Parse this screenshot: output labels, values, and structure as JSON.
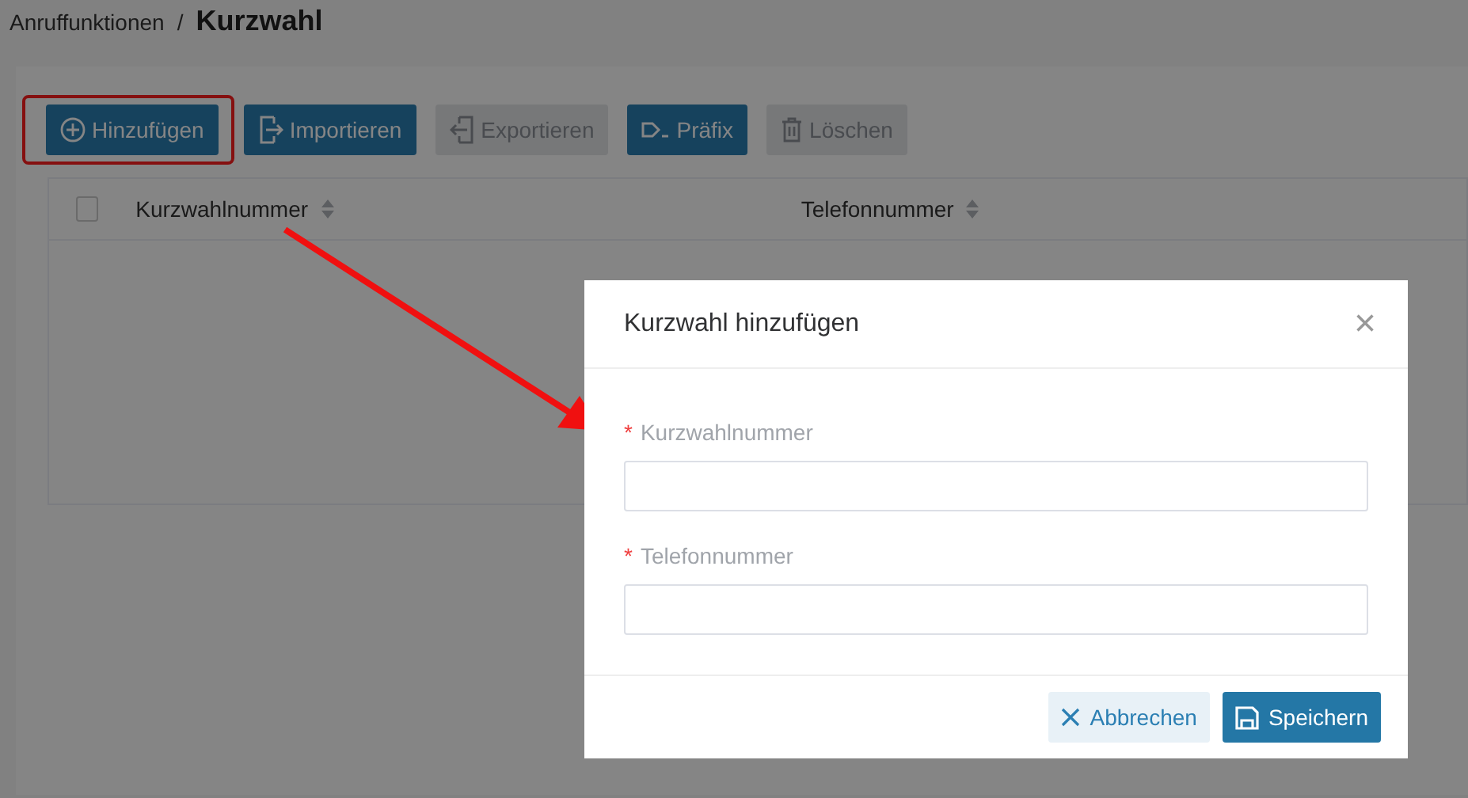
{
  "breadcrumb": {
    "parent": "Anruffunktionen",
    "separator": "/",
    "current": "Kurzwahl"
  },
  "toolbar": [
    {
      "kind": "add",
      "label": "Hinzufügen",
      "disabled": false,
      "highlighted": true
    },
    {
      "kind": "import",
      "label": "Importieren",
      "disabled": false,
      "highlighted": false
    },
    {
      "kind": "export",
      "label": "Exportieren",
      "disabled": true,
      "highlighted": false
    },
    {
      "kind": "prefix",
      "label": "Präfix",
      "disabled": false,
      "highlighted": false
    },
    {
      "kind": "delete",
      "label": "Löschen",
      "disabled": true,
      "highlighted": false
    }
  ],
  "table": {
    "select_all": {
      "checked": false
    },
    "columns": [
      "Kurzwahlnummer",
      "Telefonnummer"
    ]
  },
  "dialog": {
    "title": "Kurzwahl hinzufügen",
    "close": "×",
    "fields": [
      {
        "label": "Kurzwahlnummer",
        "required": true,
        "required_mark": "*"
      },
      {
        "label": "Telefonnummer",
        "required": true,
        "required_mark": "*"
      }
    ],
    "buttons": [
      {
        "kind": "cancel",
        "label": "Abbrechen"
      },
      {
        "kind": "save",
        "label": "Speichern"
      }
    ]
  }
}
